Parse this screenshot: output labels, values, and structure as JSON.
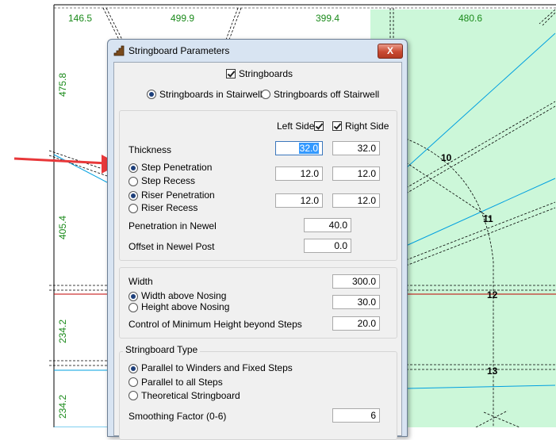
{
  "drawing": {
    "dims_top": [
      "146.5",
      "499.9",
      "399.4",
      "480.6"
    ],
    "dims_left": [
      "475.8",
      "405.4",
      "234.2",
      "234.2"
    ],
    "step_numbers": [
      "10",
      "11",
      "12",
      "13"
    ],
    "colors": {
      "dim": "#1a8a1a",
      "landing": "#ccf7d9",
      "stringer": "#00a0e0",
      "riser": "#c00000",
      "arrow": "#e8383a"
    }
  },
  "dialog": {
    "title": "Stringboard Parameters",
    "close_label": "X",
    "stringboards_label": "Stringboards",
    "in_stairwell_label": "Stringboards in Stairwell",
    "off_stairwell_label": "Stringboards off Stairwell",
    "left_side_label": "Left Side",
    "right_side_label": "Right Side",
    "thickness_label": "Thickness",
    "thickness_left": "32.0",
    "thickness_right": "32.0",
    "step_penetration_label": "Step Penetration",
    "step_recess_label": "Step Recess",
    "step_left": "12.0",
    "step_right": "12.0",
    "riser_penetration_label": "Riser Penetration",
    "riser_recess_label": "Riser Recess",
    "riser_left": "12.0",
    "riser_right": "12.0",
    "penetration_newel_label": "Penetration in Newel",
    "penetration_newel_value": "40.0",
    "offset_newel_label": "Offset in Newel Post",
    "offset_newel_value": "0.0",
    "width_label": "Width",
    "width_value": "300.0",
    "width_above_label": "Width above Nosing",
    "height_above_label": "Height above Nosing",
    "nosing_value": "30.0",
    "control_min_label": "Control of Minimum Height beyond Steps",
    "control_min_value": "20.0",
    "type_group_label": "Stringboard Type",
    "type_parallel_winders": "Parallel to Winders and Fixed Steps",
    "type_parallel_all": "Parallel to all Steps",
    "type_theoretical": "Theoretical Stringboard",
    "smoothing_label": "Smoothing Factor (0-6)",
    "smoothing_value": "6"
  }
}
